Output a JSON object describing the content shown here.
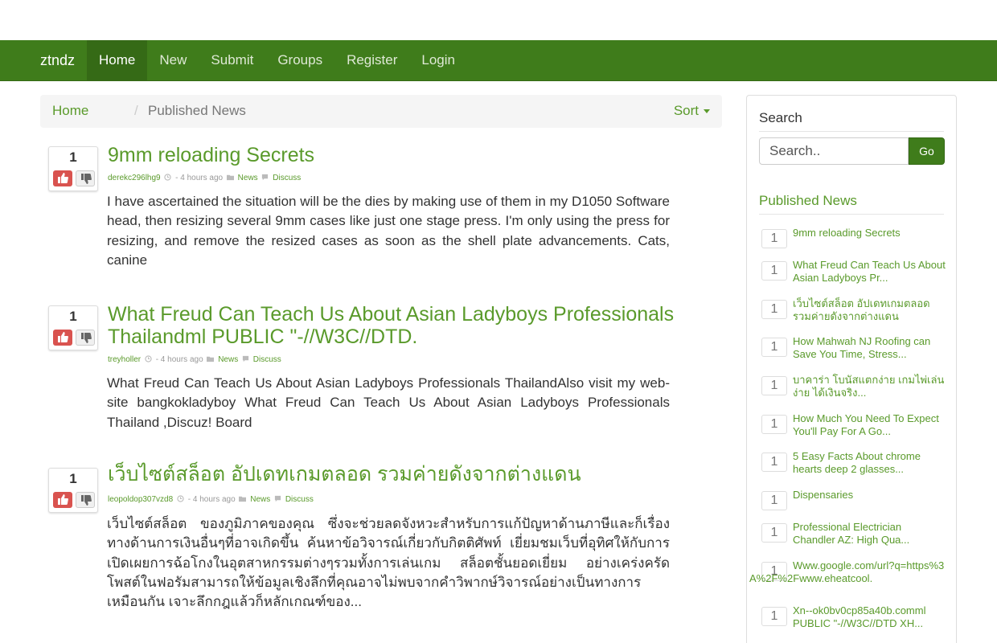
{
  "nav": {
    "brand": "ztndz",
    "items": [
      {
        "label": "Home",
        "active": true
      },
      {
        "label": "New"
      },
      {
        "label": "Submit"
      },
      {
        "label": "Groups"
      },
      {
        "label": "Register"
      },
      {
        "label": "Login"
      }
    ]
  },
  "breadcrumb": {
    "home": "Home",
    "separator": "/",
    "current": "Published News",
    "sort_label": "Sort"
  },
  "posts": [
    {
      "votes": "1",
      "title": "9mm reloading Secrets",
      "author": "derekc296lhg9",
      "time": "- 4 hours ago",
      "category": "News",
      "discuss": "Discuss",
      "body": "I have ascertained the situation will be the dies by making use of them in my D1050 Software head, then resizing several 9mm cases like just one stage press. I'm only using the press for resizing, and remove the resized cases as soon as the shell plate advancements. Cats, canine"
    },
    {
      "votes": "1",
      "title": "What Freud Can Teach Us About Asian Ladyboys Professionals Thailandml PUBLIC \"-//W3C//DTD.",
      "author": "treyholler",
      "time": "- 4 hours ago",
      "category": "News",
      "discuss": "Discuss",
      "body": "What Freud Can Teach Us About Asian Ladyboys Professionals ThailandAlso visit my web-site bangkokladyboy What Freud Can Teach Us About Asian Ladyboys Professionals Thailand ,Discuz! Board"
    },
    {
      "votes": "1",
      "title": "เว็บไซต์สล็อต อัปเดทเกมตลอด รวมค่ายดังจากต่างแดน",
      "author": "leopoldop307vzd8",
      "time": "- 4 hours ago",
      "category": "News",
      "discuss": "Discuss",
      "body": "เว็บไซต์สล็อต ของภูมิภาคของคุณ ซึ่งจะช่วยลดจังหวะสำหรับการแก้ปัญหาด้านภาษีและก็เรื่องทางด้านการเงินอื่นๆที่อาจเกิดขึ้น ค้นหาข้อวิจารณ์เกี่ยวกับกิตติศัพท์ เยี่ยมชมเว็บที่อุทิศให้กับการเปิดเผยการฉ้อโกงในอุตสาหกรรมต่างๆรวมทั้งการเล่นเกม สล็อตชั้นยอดเยี่ยม อย่างเคร่งครัด โพสต์ในฟอรัมสามารถให้ข้อมูลเชิงลึกที่คุณอาจไม่พบจากคำวิพากษ์วิจารณ์อย่างเป็นทางการเหมือนกัน เจาะลึกกฎแล้วก็หลักเกณฑ์ของ..."
    }
  ],
  "sidebar": {
    "search_heading": "Search",
    "search_placeholder": "Search..",
    "go_label": "Go",
    "published_heading": "Published News",
    "items": [
      {
        "count": "1",
        "text": "9mm reloading Secrets"
      },
      {
        "count": "1",
        "text": "What Freud Can Teach Us About Asian Ladyboys Pr..."
      },
      {
        "count": "1",
        "text": "เว็บไซต์สล็อต อัปเดทเกมตลอด รวมค่ายดังจากต่างแดน"
      },
      {
        "count": "1",
        "text": "How Mahwah NJ Roofing can Save You Time, Stress..."
      },
      {
        "count": "1",
        "text": "บาคาร่า โบนัสแตกง่าย เกมไพ่เล่นง่าย ได้เงินจริง..."
      },
      {
        "count": "1",
        "text": "How Much You Need To Expect You'll Pay For A Go..."
      },
      {
        "count": "1",
        "text": "5 Easy Facts About chrome hearts deep 2 glasses..."
      },
      {
        "count": "1",
        "text": "Dispensaries"
      },
      {
        "count": "1",
        "text": "Professional Electrician Chandler AZ: High Qua..."
      },
      {
        "count": "1",
        "text": "Www.google.com/url?q=https%3A%2F%2Fwww.eheatcool."
      },
      {
        "count": "1",
        "text": "Xn--ok0bv0cp85a40b.comml PUBLIC \"-//W3C//DTD XH..."
      }
    ]
  },
  "colors": {
    "brand_green": "#3f7c1b",
    "link_green": "#5a9a2b",
    "vote_red": "#d9534f"
  }
}
